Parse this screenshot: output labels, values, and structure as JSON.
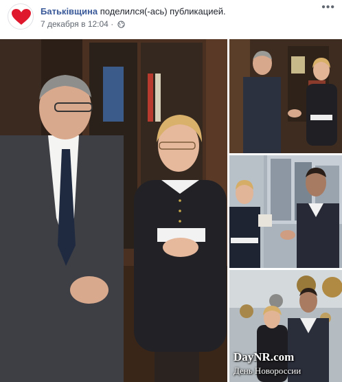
{
  "post": {
    "page_name": "Батьківщина",
    "action": "поделился(-ась) публикацией.",
    "timestamp": "7 декабря в 12:04",
    "separator": "·",
    "privacy_icon": "globe-icon",
    "avatar_icon": "heart-logo",
    "more_label": "•••"
  },
  "photos": [
    {
      "id": "main",
      "description_icon": "photo"
    },
    {
      "id": "thumb-1"
    },
    {
      "id": "thumb-2"
    },
    {
      "id": "thumb-3"
    }
  ],
  "watermark": {
    "title": "DayNR.com",
    "subtitle": "День Новороссии"
  },
  "colors": {
    "brand_red": "#e0182d",
    "link_blue": "#385898",
    "meta_gray": "#606770"
  }
}
